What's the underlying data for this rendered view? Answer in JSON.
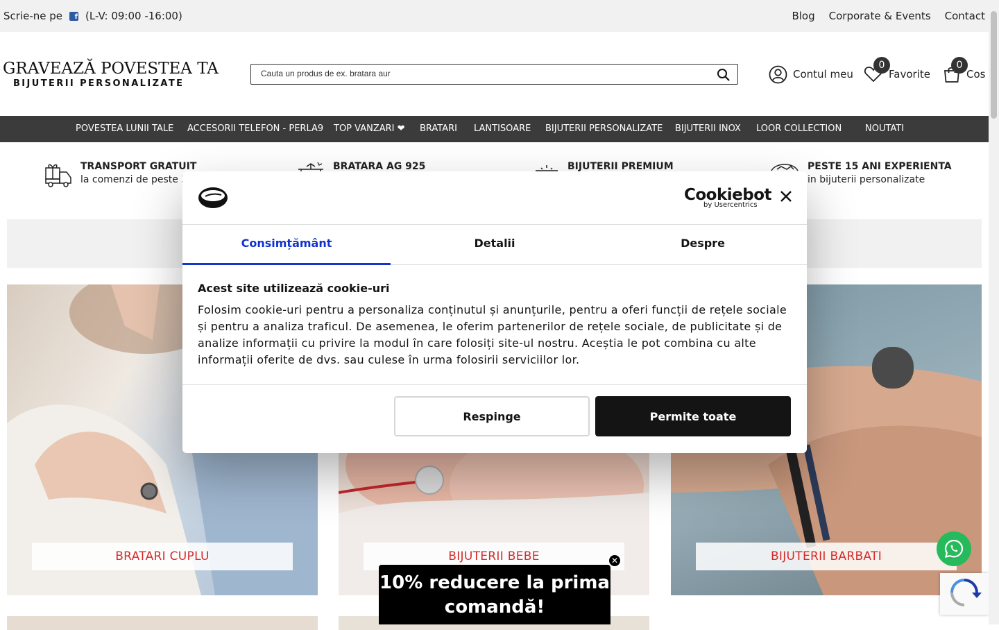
{
  "topbar": {
    "write_us": "Scrie-ne pe",
    "hours": "(L-V: 09:00 -16:00)",
    "links": [
      "Blog",
      "Corporate & Events",
      "Contact"
    ]
  },
  "logo": {
    "line1": "GRAVEAZĂ POVESTEA TA",
    "line2": "BIJUTERII PERSONALIZATE"
  },
  "search": {
    "placeholder": "Cauta un produs de ex. bratara aur"
  },
  "header": {
    "account": "Contul meu",
    "favorites": "Favorite",
    "favorites_count": "0",
    "cart": "Cos",
    "cart_count": "0"
  },
  "nav": [
    "POVESTEA LUNII TALE",
    "ACCESORII TELEFON - PERLA9",
    "TOP VANZARI ❤",
    "BRATARI",
    "LANTISOARE",
    "BIJUTERII PERSONALIZATE",
    "BIJUTERII INOX",
    "LOOR COLLECTION",
    "NOUTATI"
  ],
  "benefits": [
    {
      "title": "TRANSPORT GRATUIT",
      "text": "la comenzi de peste 3"
    },
    {
      "title": "BRATARA AG 925",
      "text": ""
    },
    {
      "title": "BIJUTERII PREMIUM",
      "text": ""
    },
    {
      "title": "PESTE 15 ANI EXPERIENTA",
      "text": "in bijuterii personalizate"
    }
  ],
  "tiles": [
    "BRATARI CUPLU",
    "BIJUTERII BEBE",
    "BIJUTERII BARBATI"
  ],
  "cookie": {
    "brand": "Cookiebot",
    "brand_sub": "by Usercentrics",
    "tabs": [
      "Consimțământ",
      "Detalii",
      "Despre"
    ],
    "heading": "Acest site utilizează cookie-uri",
    "body": "Folosim cookie-uri pentru a personaliza conținutul și anunțurile, pentru a oferi funcții de rețele sociale și pentru a analiza traficul. De asemenea, le oferim partenerilor de rețele sociale, de publicitate și de analize informații cu privire la modul în care folosiți site-ul nostru. Aceștia le pot combina cu alte informații oferite de dvs. sau culese în urma folosirii serviciilor lor.",
    "reject": "Respinge",
    "allow": "Permite toate"
  },
  "promo": {
    "line1": "10% reducere la prima",
    "line2": "comandă!"
  },
  "colors": {
    "nav_bg": "#3b3b3b",
    "accent_red": "#d52a2a",
    "cookie_blue": "#1032cf",
    "whatsapp": "#27ba5c"
  }
}
